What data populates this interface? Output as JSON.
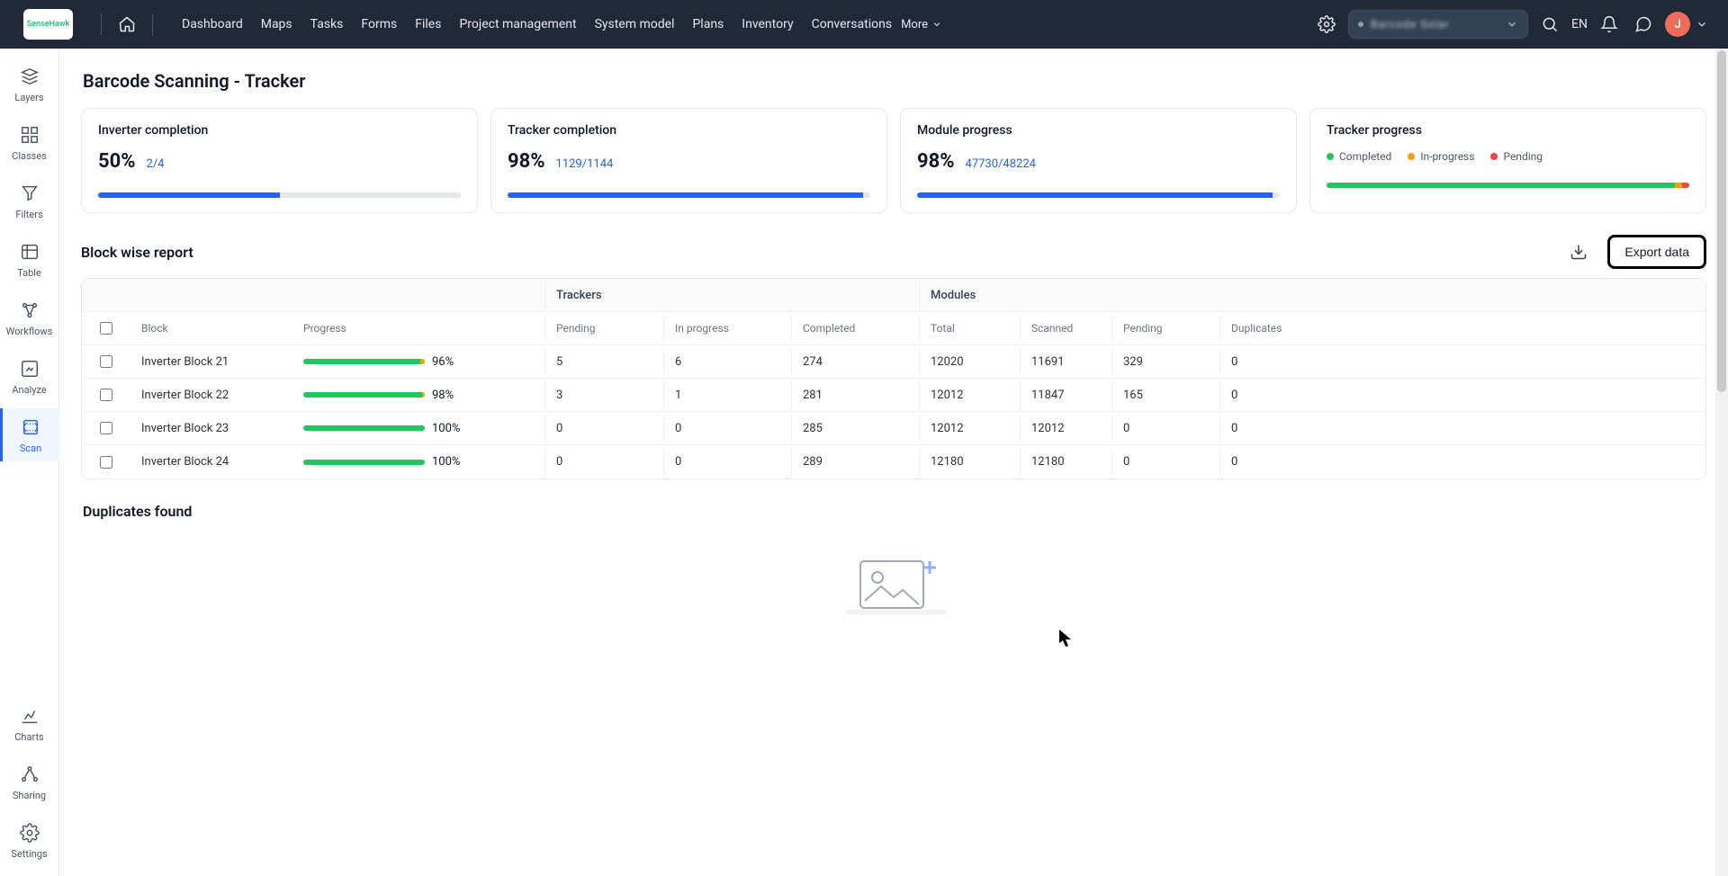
{
  "topbar": {
    "logo_text": "SenseHawk",
    "workspace_name": "Barcode Solar",
    "nav": [
      "Dashboard",
      "Maps",
      "Tasks",
      "Forms",
      "Files",
      "Project management",
      "System model",
      "Plans",
      "Inventory",
      "Conversations"
    ],
    "more": "More",
    "lang": "EN",
    "avatar_initial": "J"
  },
  "leftrail": {
    "items": [
      {
        "label": "Layers"
      },
      {
        "label": "Classes"
      },
      {
        "label": "Filters"
      },
      {
        "label": "Table"
      },
      {
        "label": "Workflows"
      },
      {
        "label": "Analyze"
      },
      {
        "label": "Scan",
        "active": true
      }
    ],
    "footer_items": [
      {
        "label": "Charts"
      },
      {
        "label": "Sharing"
      },
      {
        "label": "Settings"
      }
    ]
  },
  "page_title": "Barcode Scanning - Tracker",
  "kpis": {
    "inverter": {
      "title": "Inverter completion",
      "value": "50%",
      "frac": "2/4",
      "pct": 50
    },
    "tracker": {
      "title": "Tracker completion",
      "value": "98%",
      "frac": "1129/1144",
      "pct": 98
    },
    "module": {
      "title": "Module progress",
      "value": "98%",
      "frac": "47730/48224",
      "pct": 98
    },
    "progress": {
      "title": "Tracker progress",
      "legend": {
        "completed": "Completed",
        "inprogress": "In-progress",
        "pending": "Pending"
      },
      "seg": {
        "g": 96,
        "o": 2,
        "r": 2
      }
    }
  },
  "block_report": {
    "title": "Block wise report",
    "export_label": "Export data",
    "group_cols": {
      "trackers": "Trackers",
      "modules": "Modules"
    },
    "cols": [
      "Block",
      "Progress",
      "Pending",
      "In progress",
      "Completed",
      "Total",
      "Scanned",
      "Pending",
      "Duplicates"
    ],
    "rows": [
      {
        "block": "Inverter Block 21",
        "pct": 96,
        "pending": "5",
        "inprog": "6",
        "completed": "274",
        "total": "12020",
        "scanned": "11691",
        "mpending": "329",
        "dups": "0"
      },
      {
        "block": "Inverter Block 22",
        "pct": 98,
        "pending": "3",
        "inprog": "1",
        "completed": "281",
        "total": "12012",
        "scanned": "11847",
        "mpending": "165",
        "dups": "0"
      },
      {
        "block": "Inverter Block 23",
        "pct": 100,
        "pending": "0",
        "inprog": "0",
        "completed": "285",
        "total": "12012",
        "scanned": "12012",
        "mpending": "0",
        "dups": "0"
      },
      {
        "block": "Inverter Block 24",
        "pct": 100,
        "pending": "0",
        "inprog": "0",
        "completed": "289",
        "total": "12180",
        "scanned": "12180",
        "mpending": "0",
        "dups": "0"
      }
    ]
  },
  "duplicates_title": "Duplicates found"
}
